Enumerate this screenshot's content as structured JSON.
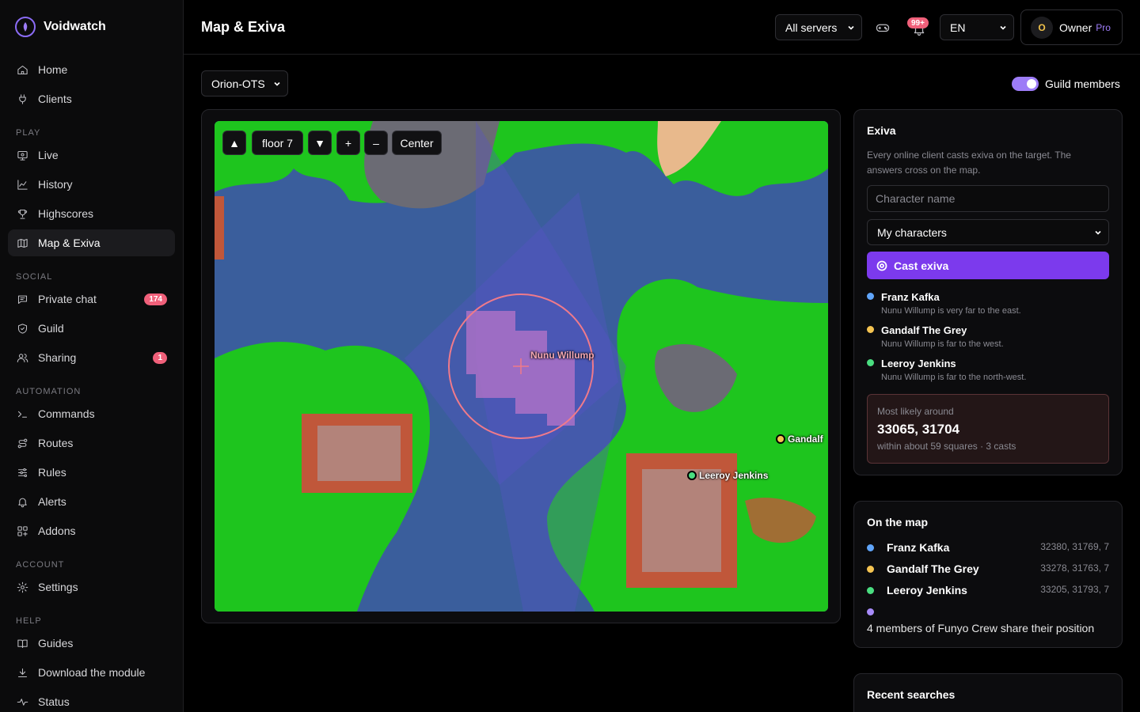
{
  "app": {
    "name": "Voidwatch"
  },
  "sidebar": {
    "items": [
      {
        "id": "home",
        "type": "item",
        "label": "Home",
        "icon": "home-icon"
      },
      {
        "id": "clients",
        "type": "item",
        "label": "Clients",
        "icon": "plug-icon"
      },
      {
        "id": "play",
        "type": "section",
        "label": "PLAY"
      },
      {
        "id": "live",
        "type": "item",
        "label": "Live",
        "icon": "monitor-icon"
      },
      {
        "id": "history",
        "type": "item",
        "label": "History",
        "icon": "chart-line-icon"
      },
      {
        "id": "highscores",
        "type": "item",
        "label": "Highscores",
        "icon": "trophy-icon"
      },
      {
        "id": "map",
        "type": "item",
        "label": "Map & Exiva",
        "icon": "map-icon",
        "active": true
      },
      {
        "id": "social",
        "type": "section",
        "label": "SOCIAL"
      },
      {
        "id": "private-chat",
        "type": "item",
        "label": "Private chat",
        "icon": "chat-icon",
        "badge": "174"
      },
      {
        "id": "guild",
        "type": "item",
        "label": "Guild",
        "icon": "shield-icon"
      },
      {
        "id": "sharing",
        "type": "item",
        "label": "Sharing",
        "icon": "users-icon",
        "badge": "1"
      },
      {
        "id": "automation",
        "type": "section",
        "label": "AUTOMATION"
      },
      {
        "id": "commands",
        "type": "item",
        "label": "Commands",
        "icon": "terminal-icon"
      },
      {
        "id": "routes",
        "type": "item",
        "label": "Routes",
        "icon": "route-icon"
      },
      {
        "id": "rules",
        "type": "item",
        "label": "Rules",
        "icon": "sliders-icon"
      },
      {
        "id": "alerts",
        "type": "item",
        "label": "Alerts",
        "icon": "bell-icon"
      },
      {
        "id": "addons",
        "type": "item",
        "label": "Addons",
        "icon": "puzzle-icon"
      },
      {
        "id": "account",
        "type": "section",
        "label": "ACCOUNT"
      },
      {
        "id": "settings",
        "type": "item",
        "label": "Settings",
        "icon": "gear-icon"
      },
      {
        "id": "help",
        "type": "section",
        "label": "HELP"
      },
      {
        "id": "guides",
        "type": "item",
        "label": "Guides",
        "icon": "book-icon"
      },
      {
        "id": "download",
        "type": "item",
        "label": "Download the module",
        "icon": "download-icon"
      },
      {
        "id": "status",
        "type": "item",
        "label": "Status",
        "icon": "pulse-icon"
      }
    ]
  },
  "header": {
    "title": "Map & Exiva",
    "server_filter": "All servers",
    "notification_badge": "99+",
    "language": "EN",
    "user": {
      "initial": "O",
      "name": "Owner",
      "plan": "Pro"
    }
  },
  "main": {
    "server": "Orion-OTS",
    "guild_toggle_label": "Guild members",
    "guild_toggle_on": true,
    "map_controls": {
      "up": "▲",
      "floor": "floor 7",
      "down": "▼",
      "zoom_in": "+",
      "zoom_out": "–",
      "center": "Center"
    },
    "map_labels": {
      "target": "Nunu Willump",
      "gandalf": "Gandalf",
      "leeroy": "Leeroy Jenkins"
    }
  },
  "exiva": {
    "title": "Exiva",
    "description": "Every online client casts exiva on the target. The answers cross on the map.",
    "name_placeholder": "Character name",
    "caster_select": "My characters",
    "cast_button": "Cast exiva",
    "answers": [
      {
        "name": "Franz Kafka",
        "text": "Nunu Willump is very far to the east.",
        "color": "#60a5fa"
      },
      {
        "name": "Gandalf The Grey",
        "text": "Nunu Willump is far to the west.",
        "color": "#f5c451"
      },
      {
        "name": "Leeroy Jenkins",
        "text": "Nunu Willump is far to the north-west.",
        "color": "#4ade80"
      }
    ],
    "likely": {
      "label": "Most likely around",
      "coords": "33065, 31704",
      "detail": "within about 59 squares · 3 casts"
    }
  },
  "on_map": {
    "title": "On the map",
    "members": [
      {
        "name": "Franz Kafka",
        "coords": "32380, 31769, 7",
        "color": "#60a5fa"
      },
      {
        "name": "Gandalf The Grey",
        "coords": "33278, 31763, 7",
        "color": "#f5c451"
      },
      {
        "name": "Leeroy Jenkins",
        "coords": "33205, 31793, 7",
        "color": "#4ade80"
      },
      {
        "name": "",
        "coords": "",
        "color": "#a78bfa"
      }
    ],
    "share_text": "4 members of Funyo Crew share their position"
  },
  "recent": {
    "title": "Recent searches"
  },
  "colors": {
    "accent": "#7c3aed",
    "badge": "#f0607a",
    "water": "#3a5e9c",
    "grass": "#1ec51e",
    "town": "#c0573a"
  }
}
